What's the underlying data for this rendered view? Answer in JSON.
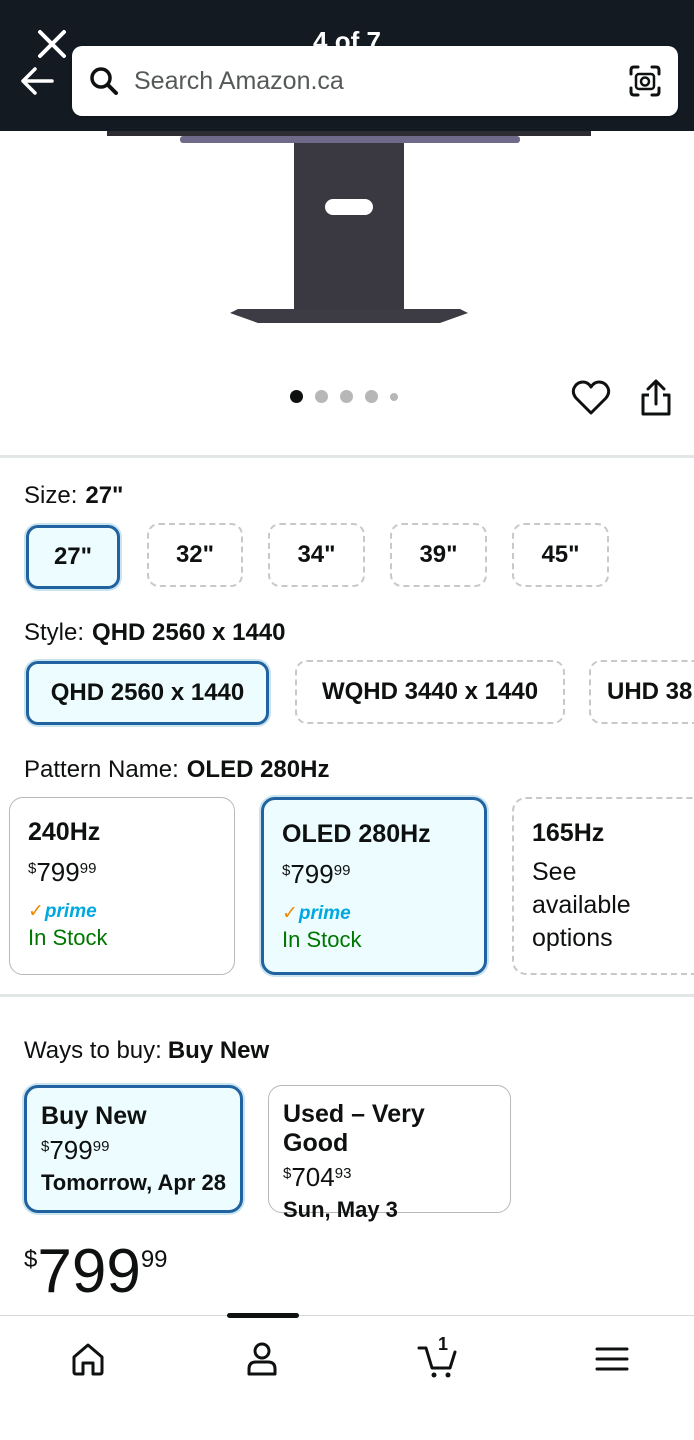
{
  "header": {
    "counter": "4 of 7",
    "search_placeholder": "Search Amazon.ca"
  },
  "gallery": {
    "dots": 5,
    "active_dot": 0
  },
  "size": {
    "label": "Size:",
    "selected": "27\"",
    "options": [
      "27\"",
      "32\"",
      "34\"",
      "39\"",
      "45\""
    ]
  },
  "style": {
    "label": "Style:",
    "selected": "QHD 2560 x 1440",
    "options": [
      "QHD 2560 x 1440",
      "WQHD 3440 x 1440",
      "UHD 38"
    ]
  },
  "pattern": {
    "label": "Pattern Name:",
    "selected": "OLED 280Hz",
    "cards": [
      {
        "title": "240Hz",
        "price_symbol": "$",
        "price_whole": "799",
        "price_cents": "99",
        "prime": "prime",
        "stock": "In Stock"
      },
      {
        "title": "OLED 280Hz",
        "price_symbol": "$",
        "price_whole": "799",
        "price_cents": "99",
        "prime": "prime",
        "stock": "In Stock"
      },
      {
        "title": "165Hz",
        "text": "See available options"
      }
    ]
  },
  "ways_to_buy": {
    "label": "Ways to buy:",
    "selected": "Buy New",
    "options": [
      {
        "title": "Buy New",
        "price_symbol": "$",
        "price_whole": "799",
        "price_cents": "99",
        "date": "Tomorrow, Apr 28"
      },
      {
        "title": "Used – Very Good",
        "price_symbol": "$",
        "price_whole": "704",
        "price_cents": "93",
        "date": "Sun, May 3"
      }
    ]
  },
  "price": {
    "symbol": "$",
    "whole": "799",
    "cents": "99"
  },
  "cart": {
    "count": "1"
  },
  "colors": {
    "header_bg": "#131a22",
    "selected_border": "#2162a1",
    "selected_bg": "#edfdff",
    "in_stock": "#007600",
    "prime_blue": "#00a8e1",
    "prime_check": "#f08804"
  }
}
